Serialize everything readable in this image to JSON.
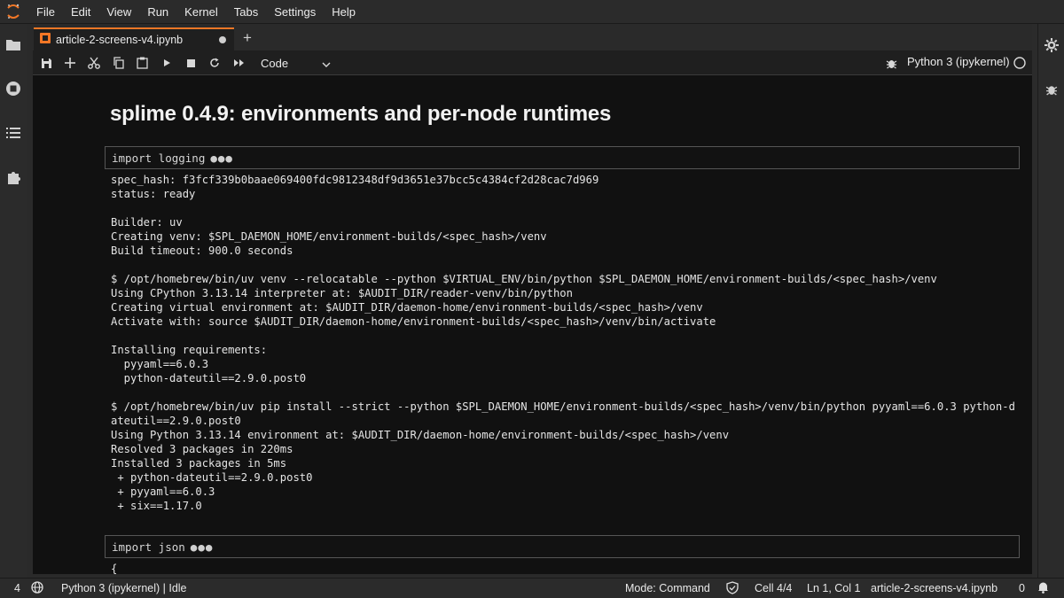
{
  "app": {
    "menu": [
      "File",
      "Edit",
      "View",
      "Run",
      "Kernel",
      "Tabs",
      "Settings",
      "Help"
    ],
    "accent": "#f37726"
  },
  "left_sidebar": {
    "icons": [
      "folder-icon",
      "running-icon",
      "toc-icon",
      "extensions-icon"
    ]
  },
  "right_sidebar": {
    "icons": [
      "property-inspector-icon",
      "debugger-icon"
    ]
  },
  "tab": {
    "title": "article-2-screens-v4.ipynb",
    "unsaved": true
  },
  "toolbar": {
    "buttons": [
      "save-icon",
      "add-icon",
      "cut-icon",
      "copy-icon",
      "paste-icon",
      "run-icon",
      "stop-icon",
      "restart-icon",
      "fast-forward-icon"
    ],
    "cell_type": "Code",
    "kernel_label": "Python 3 (ipykernel)"
  },
  "notebook": {
    "title": "splime 0.4.9: environments and per-node runtimes",
    "cell1_code": "import logging",
    "cell1_output": "spec_hash: f3fcf339b0baae069400fdc9812348df9d3651e37bcc5c4384cf2d28cac7d969\nstatus: ready\n\nBuilder: uv\nCreating venv: $SPL_DAEMON_HOME/environment-builds/<spec_hash>/venv\nBuild timeout: 900.0 seconds\n\n$ /opt/homebrew/bin/uv venv --relocatable --python $VIRTUAL_ENV/bin/python $SPL_DAEMON_HOME/environment-builds/<spec_hash>/venv\nUsing CPython 3.13.14 interpreter at: $AUDIT_DIR/reader-venv/bin/python\nCreating virtual environment at: $AUDIT_DIR/daemon-home/environment-builds/<spec_hash>/venv\nActivate with: source $AUDIT_DIR/daemon-home/environment-builds/<spec_hash>/venv/bin/activate\n\nInstalling requirements:\n  pyyaml==6.0.3\n  python-dateutil==2.9.0.post0\n\n$ /opt/homebrew/bin/uv pip install --strict --python $SPL_DAEMON_HOME/environment-builds/<spec_hash>/venv/bin/python pyyaml==6.0.3 python-d\nateutil==2.9.0.post0\nUsing Python 3.13.14 environment at: $AUDIT_DIR/daemon-home/environment-builds/<spec_hash>/venv\nResolved 3 packages in 220ms\nInstalled 3 packages in 5ms\n + python-dateutil==2.9.0.post0\n + pyyaml==6.0.3\n + six==1.17.0",
    "cell2_code": "import json",
    "cell2_output": "{",
    "ellipsis": "●●●"
  },
  "status": {
    "terminals": "4",
    "kernel": "Python 3 (ipykernel) | Idle",
    "mode": "Mode: Command",
    "cell": "Cell 4/4",
    "cursor": "Ln 1, Col 1",
    "file": "article-2-screens-v4.ipynb",
    "notifications": "0"
  }
}
